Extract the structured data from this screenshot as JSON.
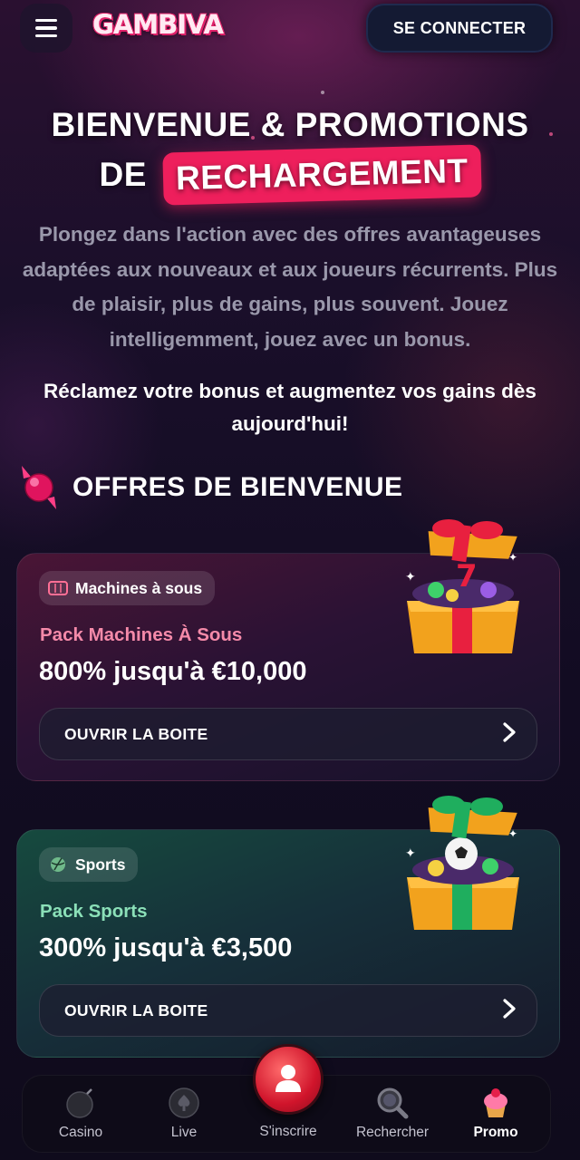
{
  "header": {
    "logo_text": "GAMBIVA",
    "login_label": "SE CONNECTER"
  },
  "hero": {
    "title_line1": "BIENVENUE & PROMOTIONS",
    "title_line2_prefix": "DE",
    "title_highlight": "RECHARGEMENT",
    "description": "Plongez dans l'action avec des offres avantageuses adaptées aux nouveaux et aux joueurs récurrents. Plus de plaisir, plus de gains, plus souvent. Jouez intelligemment, jouez avec un bonus.",
    "cta_text": "Réclamez votre bonus et augmentez vos gains dès aujourd'hui!"
  },
  "welcome_section": {
    "title": "OFFRES DE BIENVENUE"
  },
  "offers": [
    {
      "category": "Machines à sous",
      "pack_name": "Pack Machines À Sous",
      "value": "800% jusqu'à €10,000",
      "button_label": "OUVRIR LA BOITE",
      "accent_color": "#f58aa9"
    },
    {
      "category": "Sports",
      "pack_name": "Pack Sports",
      "value": "300% jusqu'à €3,500",
      "button_label": "OUVRIR LA BOITE",
      "accent_color": "#8be0b8"
    }
  ],
  "bottom_nav": {
    "items": [
      {
        "label": "Casino",
        "icon": "bomb-icon"
      },
      {
        "label": "Live",
        "icon": "spade-icon"
      },
      {
        "label": "S'inscrire",
        "icon": "user-icon"
      },
      {
        "label": "Rechercher",
        "icon": "magnifier-icon"
      },
      {
        "label": "Promo",
        "icon": "cupcake-icon"
      }
    ],
    "active": "Promo"
  },
  "colors": {
    "highlight": "#ee1f5c",
    "background": "#120c22"
  }
}
